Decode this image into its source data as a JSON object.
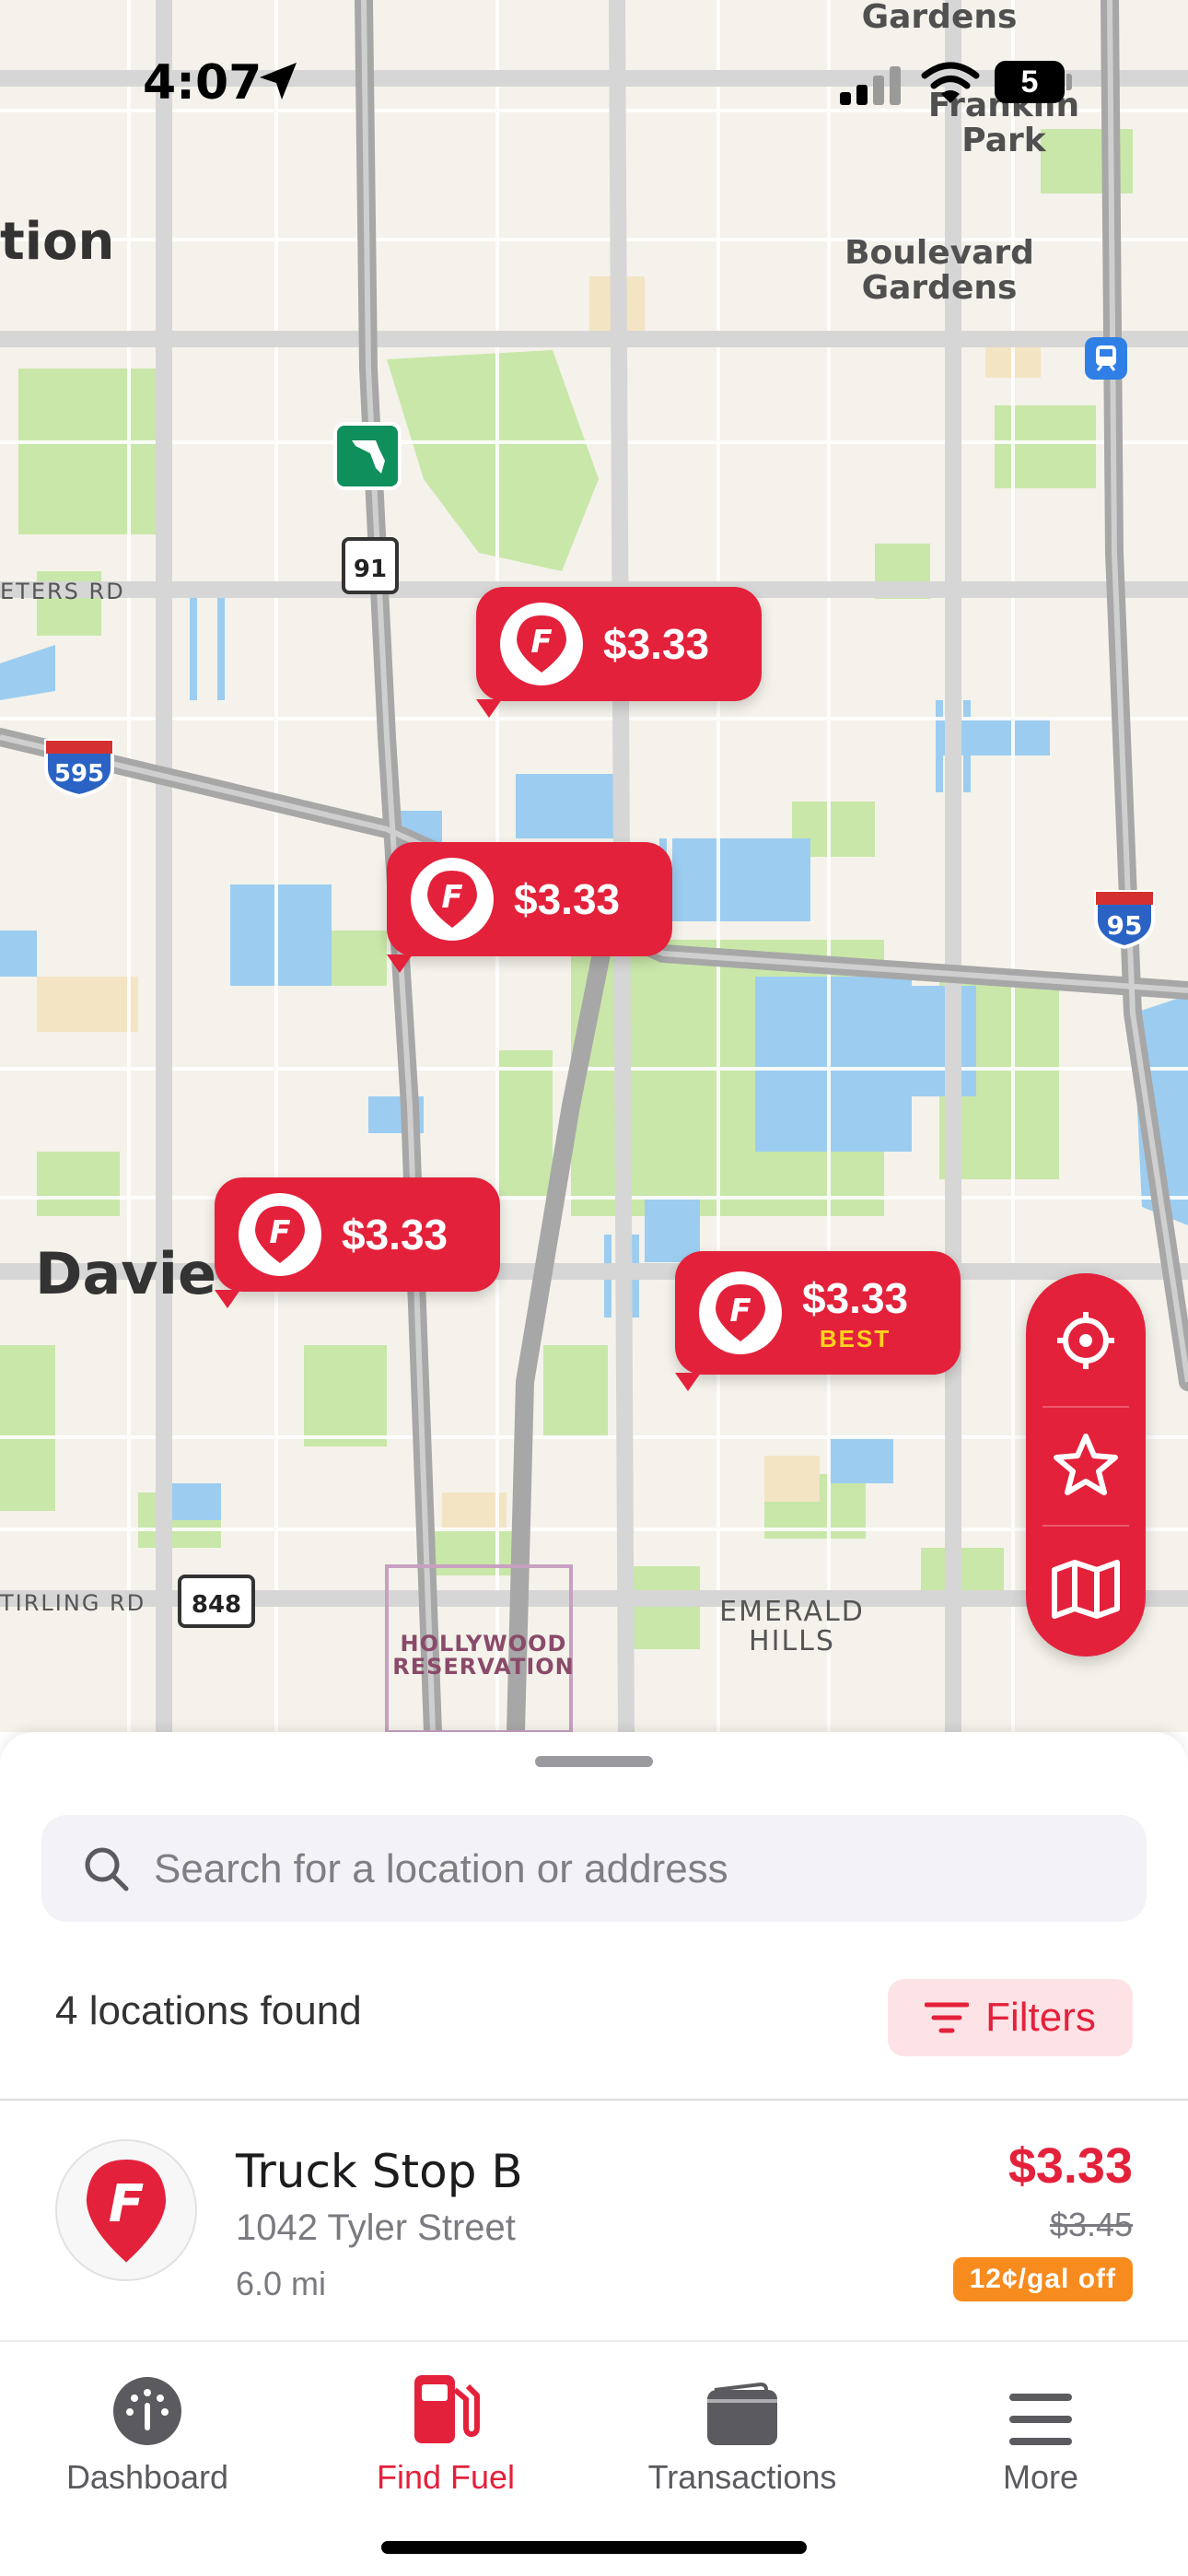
{
  "status": {
    "time": "4:07",
    "battery": "5"
  },
  "colors": {
    "brand": "#e4213b",
    "best": "#ffd21f",
    "discount": "#f78b1e"
  },
  "map": {
    "labels": {
      "gardens": "Gardens",
      "franklin_park": "Franklin\nPark",
      "boulevard_gardens": "Boulevard\nGardens",
      "city_left": "tion",
      "davie": "Davie",
      "peters_rd": "ETERS RD",
      "sterling_rd": "TIRLING RD",
      "emerald_hills": "EMERALD\nHILLS",
      "hollywood_reservation": "HOLLYWOOD\nRESERVATION"
    },
    "shields": {
      "i595": "595",
      "i95": "95",
      "sr91": "91",
      "sr848": "848"
    },
    "pins": [
      {
        "price": "$3.33",
        "best": ""
      },
      {
        "price": "$3.33",
        "best": ""
      },
      {
        "price": "$3.33",
        "best": ""
      },
      {
        "price": "$3.33",
        "best": "BEST"
      }
    ]
  },
  "fab": {
    "icons": [
      "crosshair-icon",
      "star-icon",
      "map-icon"
    ]
  },
  "sheet": {
    "search_placeholder": "Search for a location or address",
    "count_text": "4 locations found",
    "filters_label": "Filters",
    "station": {
      "name": "Truck Stop B",
      "address": "1042 Tyler Street",
      "distance": "6.0 mi",
      "price": "$3.33",
      "original_price": "$3.45",
      "discount": "12¢/gal off"
    }
  },
  "tabs": [
    {
      "label": "Dashboard",
      "icon": "gauge-icon"
    },
    {
      "label": "Find Fuel",
      "icon": "fuel-pump-icon"
    },
    {
      "label": "Transactions",
      "icon": "wallet-icon"
    },
    {
      "label": "More",
      "icon": "menu-icon"
    }
  ]
}
